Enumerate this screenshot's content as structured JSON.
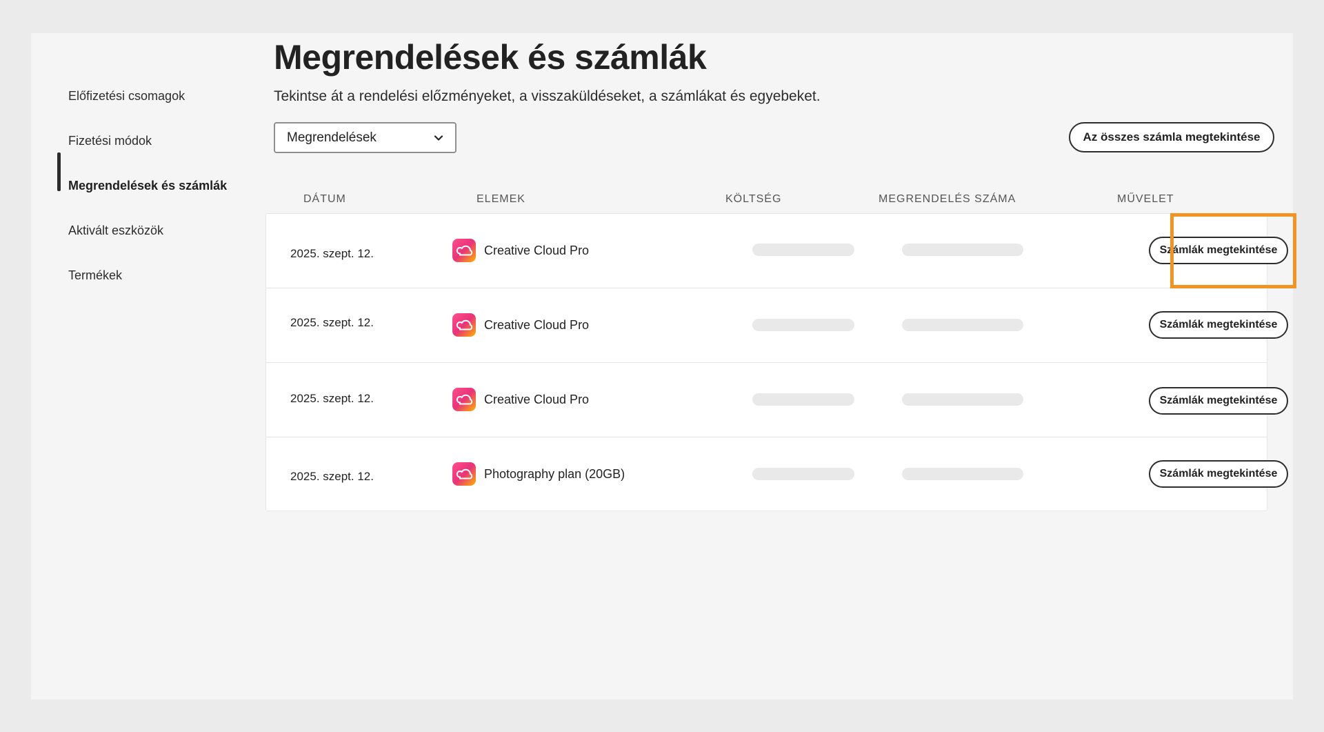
{
  "sidebar": {
    "items": [
      {
        "label": "Előfizetési csomagok",
        "active": false
      },
      {
        "label": "Fizetési módok",
        "active": false
      },
      {
        "label": "Megrendelések és számlák",
        "active": true
      },
      {
        "label": "Aktivált eszközök",
        "active": false
      },
      {
        "label": "Termékek",
        "active": false
      }
    ]
  },
  "main": {
    "title": "Megrendelések és számlák",
    "subtitle": "Tekintse át a rendelési előzményeket, a visszaküldéseket, a számlákat és egyebeket.",
    "filter": {
      "selected": "Megrendelések"
    },
    "view_all_label": "Az összes számla megtekintése"
  },
  "table": {
    "columns": [
      "DÁTUM",
      "ELEMEK",
      "KÖLTSÉG",
      "MEGRENDELÉS SZÁMA",
      "MŰVELET"
    ],
    "rows": [
      {
        "date": "2025. szept. 12.",
        "item": "Creative Cloud Pro",
        "action": "Számlák megtekintése"
      },
      {
        "date": "2025. szept. 12.",
        "item": "Creative Cloud Pro",
        "action": "Számlák megtekintése"
      },
      {
        "date": "2025. szept. 12.",
        "item": "Creative Cloud Pro",
        "action": "Számlák megtekintése"
      },
      {
        "date": "2025. szept. 12.",
        "item": "Photography plan (20GB)",
        "action": "Számlák megtekintése"
      }
    ]
  },
  "colors": {
    "highlight": "#f29423",
    "active_indicator": "#2c2c2c",
    "skeleton": "#e9e9e9"
  },
  "icons": {
    "product": "creative-cloud-icon",
    "dropdown": "chevron-down-icon"
  }
}
